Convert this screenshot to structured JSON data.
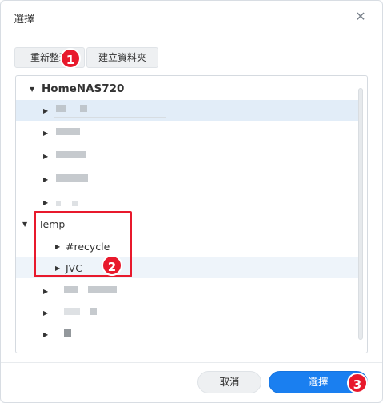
{
  "dialog": {
    "title": "選擇"
  },
  "toolbar": {
    "refresh_label": "重新整理",
    "new_folder_label": "建立資料夾"
  },
  "tree": {
    "root": "HomeNAS720",
    "temp_folder": "Temp",
    "temp_children": [
      "#recycle",
      "JVC"
    ]
  },
  "footer": {
    "cancel_label": "取消",
    "ok_label": "選擇"
  },
  "annotations": {
    "badge1": "1",
    "badge2": "2",
    "badge3": "3"
  },
  "colors": {
    "accent": "#1a7ff0",
    "annotation": "#e8192c",
    "selected_row": "#e2edf8"
  },
  "icons": {
    "close": "close-icon",
    "expand": "caret-down-icon",
    "collapse": "caret-right-icon"
  }
}
